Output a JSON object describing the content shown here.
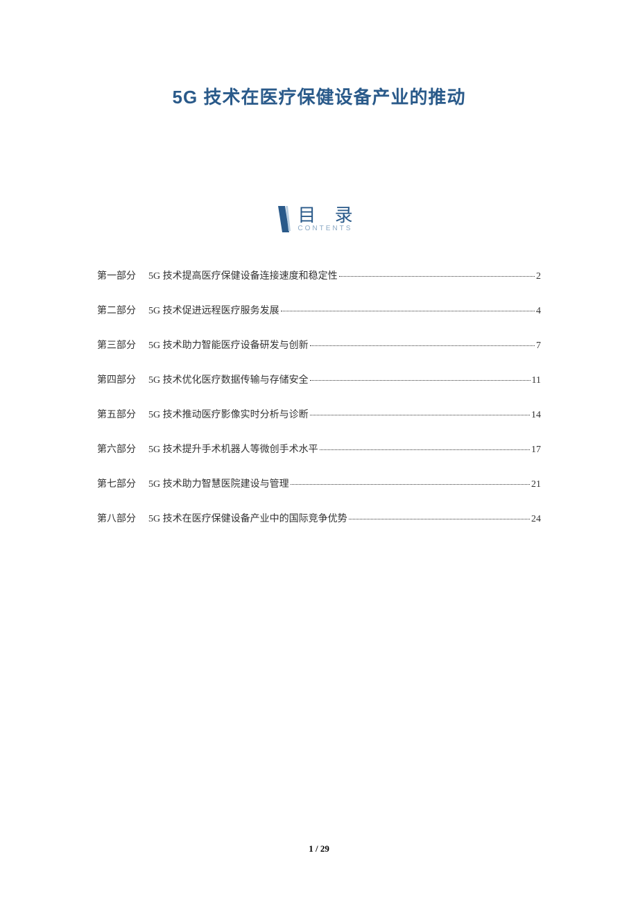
{
  "title": "5G 技术在医疗保健设备产业的推动",
  "toc_header": {
    "title": "目 录",
    "subtitle": "CONTENTS"
  },
  "toc": [
    {
      "part": "第一部分",
      "text": "5G 技术提高医疗保健设备连接速度和稳定性",
      "page": "2"
    },
    {
      "part": "第二部分",
      "text": "5G 技术促进远程医疗服务发展",
      "page": "4"
    },
    {
      "part": "第三部分",
      "text": "5G 技术助力智能医疗设备研发与创新",
      "page": "7"
    },
    {
      "part": "第四部分",
      "text": "5G 技术优化医疗数据传输与存储安全",
      "page": "11"
    },
    {
      "part": "第五部分",
      "text": "5G 技术推动医疗影像实时分析与诊断",
      "page": "14"
    },
    {
      "part": "第六部分",
      "text": "5G 技术提升手术机器人等微创手术水平",
      "page": "17"
    },
    {
      "part": "第七部分",
      "text": "5G 技术助力智慧医院建设与管理",
      "page": "21"
    },
    {
      "part": "第八部分",
      "text": "5G 技术在医疗保健设备产业中的国际竞争优势",
      "page": "24"
    }
  ],
  "footer": {
    "current": "1",
    "sep": " / ",
    "total": "29"
  }
}
